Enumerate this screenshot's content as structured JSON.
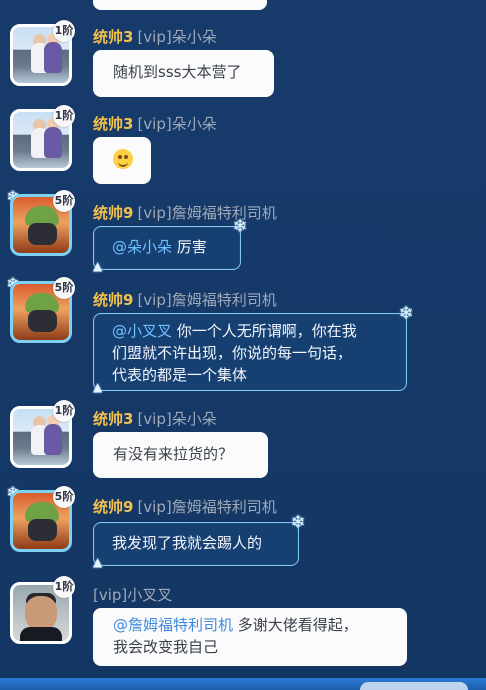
{
  "messages": [
    {
      "title": "统帅3",
      "name": "[vip]朵小朵",
      "rank": "1阶",
      "text": "随机到sss大本营了",
      "theme": "white"
    },
    {
      "title": "统帅3",
      "name": "[vip]朵小朵",
      "rank": "1阶",
      "emoji": "laughing-emoji",
      "theme": "white"
    },
    {
      "title": "统帅9",
      "name": "[vip]詹姆福特利司机",
      "rank": "5阶",
      "mention": "@朵小朵",
      "text": " 厉害",
      "theme": "blue"
    },
    {
      "title": "统帅9",
      "name": "[vip]詹姆福特利司机",
      "rank": "5阶",
      "mention": "@小叉叉",
      "text_lines": [
        " 你一个人无所谓啊，你在我",
        "们盟就不许出现，你说的每一句话，",
        "代表的都是一个集体"
      ],
      "theme": "blue"
    },
    {
      "title": "统帅3",
      "name": "[vip]朵小朵",
      "rank": "1阶",
      "text": "有没有来拉货的？",
      "theme": "white"
    },
    {
      "title": "统帅9",
      "name": "[vip]詹姆福特利司机",
      "rank": "5阶",
      "text": "我发现了我就会踢人的",
      "theme": "blue"
    },
    {
      "name": "[vip]小叉叉",
      "rank": "1阶",
      "mention": "@詹姆福特利司机",
      "text_lines": [
        " 多谢大佬看得起，",
        "我会改变我自己"
      ],
      "theme": "white"
    }
  ],
  "colors": {
    "background": "#163a6a",
    "rank_title": "#f2c14d",
    "name": "#9fa9b8",
    "blue_bubble_border": "#7ecbf1",
    "mention_blue": "#6fc3ff",
    "mention_dark_blue": "#3f8ae0"
  },
  "icons": {
    "snowflake": "snowflake-icon",
    "tree": "snow-tree-icon"
  }
}
